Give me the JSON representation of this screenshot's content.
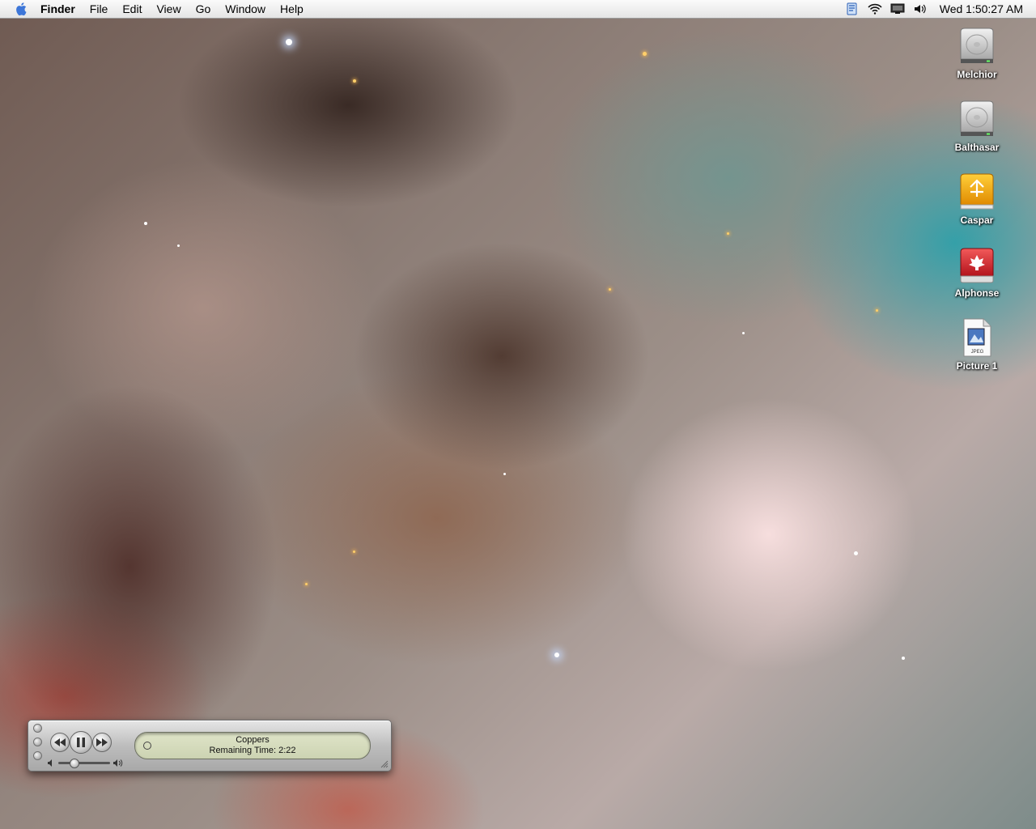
{
  "menubar": {
    "apple_icon": "apple-icon",
    "items": [
      "Finder",
      "File",
      "Edit",
      "View",
      "Go",
      "Window",
      "Help"
    ],
    "clock": "Wed 1:50:27 AM",
    "status_icons": [
      "script-icon",
      "airport-icon",
      "display-icon",
      "volume-icon"
    ]
  },
  "desktop": {
    "icons": [
      {
        "label": "Melchior",
        "icon": "hard-drive-icon"
      },
      {
        "label": "Balthasar",
        "icon": "hard-drive-icon"
      },
      {
        "label": "Caspar",
        "icon": "firewire-drive-icon"
      },
      {
        "label": "Alphonse",
        "icon": "red-disk-icon"
      },
      {
        "label": "Picture 1",
        "icon": "jpeg-file-icon",
        "badge": "JPEG"
      }
    ]
  },
  "player": {
    "track": "Coppers",
    "remaining": "Remaining Time: 2:22",
    "volume_fraction": 0.25
  }
}
